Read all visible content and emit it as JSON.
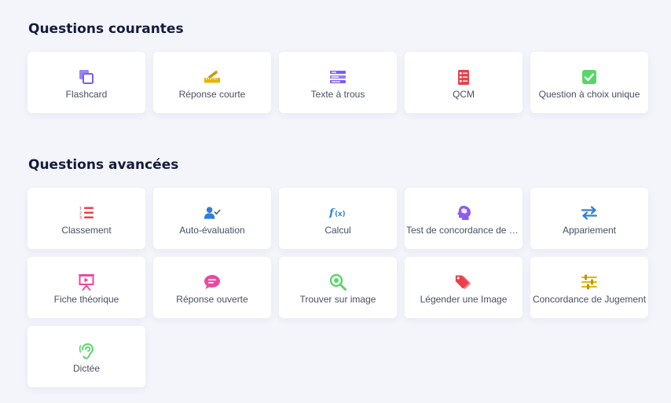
{
  "sections": {
    "common": {
      "title": "Questions courantes",
      "items": [
        {
          "label": "Flashcard",
          "icon": "flashcard-icon",
          "color": "#7b5cf0"
        },
        {
          "label": "Réponse courte",
          "icon": "pencil-ruler-icon",
          "color": "#e6b400"
        },
        {
          "label": "Texte à trous",
          "icon": "text-lines-icon",
          "color": "#7b5cf0"
        },
        {
          "label": "QCM",
          "icon": "checklist-icon",
          "color": "#e8414c"
        },
        {
          "label": "Question à choix unique",
          "icon": "checkbox-icon",
          "color": "#5ad56a"
        }
      ]
    },
    "advanced": {
      "title": "Questions avancées",
      "items": [
        {
          "label": "Classement",
          "icon": "ordered-list-icon",
          "color": "#e8414c"
        },
        {
          "label": "Auto-évaluation",
          "icon": "user-check-icon",
          "color": "#2f7fd8"
        },
        {
          "label": "Calcul",
          "icon": "function-icon",
          "color": "#2f7fd8"
        },
        {
          "label": "Test de concordance de script",
          "icon": "brain-head-icon",
          "color": "#8b5cf0"
        },
        {
          "label": "Appariement",
          "icon": "swap-arrows-icon",
          "color": "#2f7fd8"
        },
        {
          "label": "Fiche théorique",
          "icon": "presentation-icon",
          "color": "#e84aa0"
        },
        {
          "label": "Réponse ouverte",
          "icon": "speech-bubble-icon",
          "color": "#e84aa0"
        },
        {
          "label": "Trouver sur image",
          "icon": "magnifier-icon",
          "color": "#5ad56a"
        },
        {
          "label": "Légender une Image",
          "icon": "tags-icon",
          "color": "#e8414c"
        },
        {
          "label": "Concordance de Jugement",
          "icon": "sliders-icon",
          "color": "#e6b400"
        },
        {
          "label": "Dictée",
          "icon": "ear-icon",
          "color": "#5ad56a"
        }
      ]
    }
  }
}
